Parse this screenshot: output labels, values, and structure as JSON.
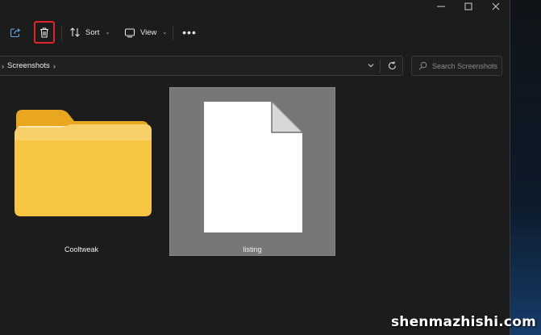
{
  "toolbar": {
    "share_icon": "share-icon",
    "delete_icon": "trash-icon",
    "sort_label": "Sort",
    "view_label": "View",
    "more_label": "•••",
    "highlight_color": "#e0242c"
  },
  "address": {
    "path": [
      "Screenshots"
    ],
    "search_placeholder": "Search Screenshots"
  },
  "items": [
    {
      "name": "Cooltweak",
      "type": "folder",
      "selected": false
    },
    {
      "name": "listing",
      "type": "file",
      "selected": true
    }
  ],
  "watermark": "shenmazhishi.com",
  "colors": {
    "background": "#1c1c1c",
    "folder_yellow": "#f6c542",
    "selection": "#777777"
  }
}
